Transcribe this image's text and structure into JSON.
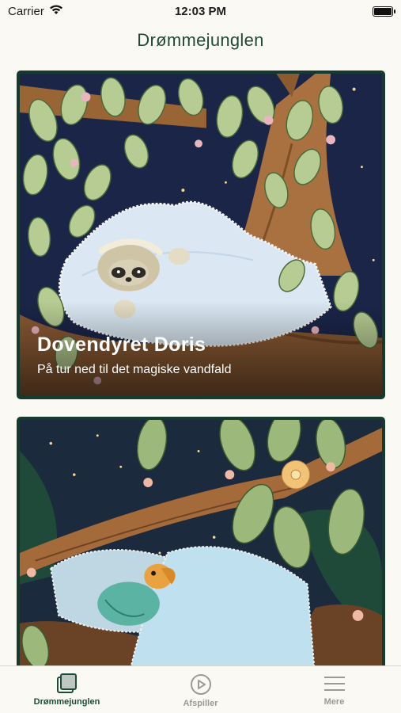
{
  "status_bar": {
    "carrier": "Carrier",
    "time": "12:03 PM"
  },
  "nav": {
    "title": "Drømmejunglen"
  },
  "stories": [
    {
      "title": "Dovendyret Doris",
      "subtitle": "På tur ned til det magiske vandfald"
    },
    {
      "title": "",
      "subtitle": ""
    }
  ],
  "tab_bar": {
    "items": [
      {
        "label": "Drømmejunglen",
        "icon": "library-icon",
        "active": true
      },
      {
        "label": "Afspiller",
        "icon": "play-circle-icon",
        "active": false
      },
      {
        "label": "Mere",
        "icon": "menu-icon",
        "active": false
      }
    ]
  },
  "colors": {
    "accent": "#1f4a3a",
    "background": "#fbf9f3",
    "card_border": "#173a2e",
    "inactive_tab": "#9a9a9a"
  }
}
